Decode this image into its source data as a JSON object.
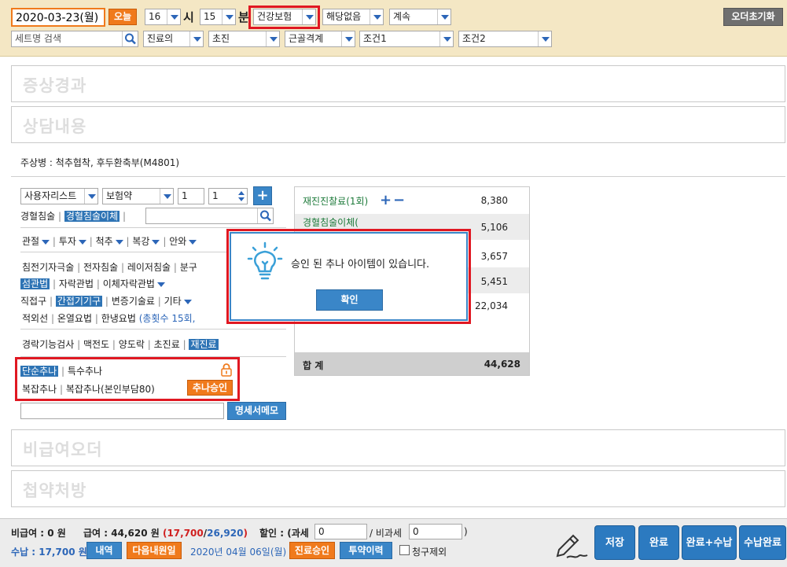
{
  "top": {
    "date": "2020-03-23(월)",
    "today_btn": "오늘",
    "hour": "16",
    "hour_unit": "시",
    "minute": "15",
    "minute_unit": "분",
    "insurance": "건강보험",
    "special": "해당없음",
    "visit_type": "계속",
    "reset_btn": "오더초기화",
    "set_search_placeholder": "세트명 검색",
    "dept": "진료의",
    "exam": "초진",
    "body": "근골격계",
    "cond1": "조건1",
    "cond2": "조건2"
  },
  "panels": {
    "symptom": "증상경과",
    "consult": "상담내용",
    "nonpay": "비급여오더",
    "herbal": "첩약처방"
  },
  "diagnosis": "주상병 : 척추협착, 후두환축부(M4801)",
  "order": {
    "list_select": "사용자리스트",
    "drug_select": "보험약",
    "qty1": "1",
    "qty2": "1",
    "add_btn": "+",
    "acupuncture": "경혈침술",
    "acupuncture_multi": "경혈침술이체",
    "cat_joint": "관절",
    "cat_tupja": "투자",
    "cat_spine": "척추",
    "cat_abdomen": "복강",
    "cat_other": "안와",
    "row3a": "침전기자극술",
    "row3b": "전자침술",
    "row3c": "레이저침술",
    "row3d": "분구",
    "row4a": "섬관법",
    "row4b": "자락관법",
    "row4c": "이체자락관법",
    "row5a": "직접구",
    "row5b": "간접기기구",
    "row5c": "변증기술료",
    "row5d": "기타",
    "row6a": "적외선",
    "row6b": "온열요법",
    "row6c": "한냉요법",
    "row6d": "(총횟수 15회,",
    "row7a": "경락기능검사",
    "row7b": "맥전도",
    "row7c": "양도락",
    "row7d": "초진료",
    "row7e": "재진료",
    "chuna_simple": "단순추나",
    "chuna_special": "특수추나",
    "chuna_complex": "복잡추나",
    "chuna_complex2": "복잡추나(본인부담80)",
    "chuna_approve": "추나승인",
    "memo_btn": "명세서메모"
  },
  "fees": {
    "rows": [
      {
        "name": "재진진찰료(1회)",
        "amount": "8,380"
      },
      {
        "name": "경혈침술이체(",
        "amount": "5,106"
      },
      {
        "name": "",
        "amount": "3,657"
      },
      {
        "name": "",
        "amount": "5,451"
      },
      {
        "name": "",
        "amount": "22,034"
      }
    ],
    "total_label": "합 계",
    "total": "44,628"
  },
  "dialog": {
    "message": "승인 된 추나 아이템이 있습니다.",
    "ok": "확인"
  },
  "bottom": {
    "nonpay_label": "비급여 : 0 원",
    "pay_label": "급여 : 44,620 원",
    "pay_paren_open": "(",
    "pay_a": "17,700",
    "pay_slash": "/",
    "pay_b": "26,920",
    "pay_paren_close": ")",
    "discount_label": "할인 : (과세",
    "discount_tax": "0",
    "discount_mid": "/ 비과세",
    "discount_notax": "0",
    "discount_end": ")",
    "receive_label": "수납 : 17,700 원",
    "detail_btn": "내역",
    "next_visit_btn": "다음내원일",
    "next_date": "2020년 04월 06일(월)",
    "approve_btn": "진료승인",
    "history_btn": "투약이력",
    "exclude_claim": "청구제외",
    "save": "저장",
    "done": "완료",
    "done_receive": "완료+수납",
    "receive_done": "수납완료"
  },
  "colors": {
    "accent_red": "#e01822",
    "orange": "#f07a1c",
    "blue": "#2c7ac0"
  }
}
